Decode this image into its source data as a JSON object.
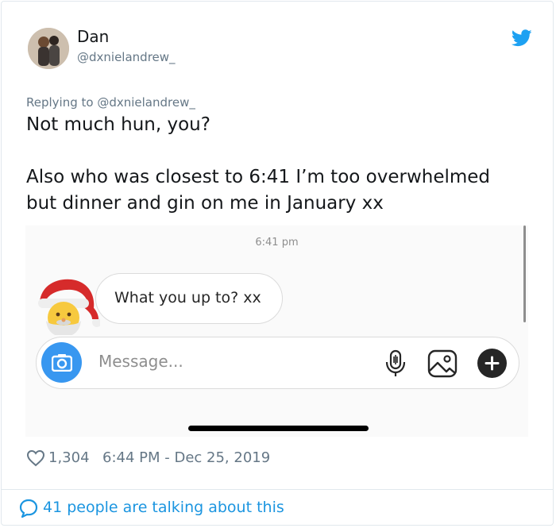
{
  "author": {
    "name": "Dan",
    "handle": "@dxnielandrew_"
  },
  "tweet": {
    "replying_to": "Replying to @dxnielandrew_",
    "lines": [
      "Not much hun, you?",
      "Also who was closest to 6:41 I’m too overwhelmed",
      "but dinner and gin on me in January xx"
    ]
  },
  "screenshot": {
    "time": "6:41 pm",
    "message": "What you up to? xx",
    "composer_placeholder": "Message..."
  },
  "footer": {
    "likes": "1,304",
    "timestamp": "6:44 PM - Dec 25, 2019",
    "talking": "41 people are talking about this"
  },
  "colors": {
    "twitter_blue": "#1da1f2",
    "link_blue": "#1b95e0",
    "camera_blue": "#3897f0",
    "muted_gray": "#657786"
  }
}
